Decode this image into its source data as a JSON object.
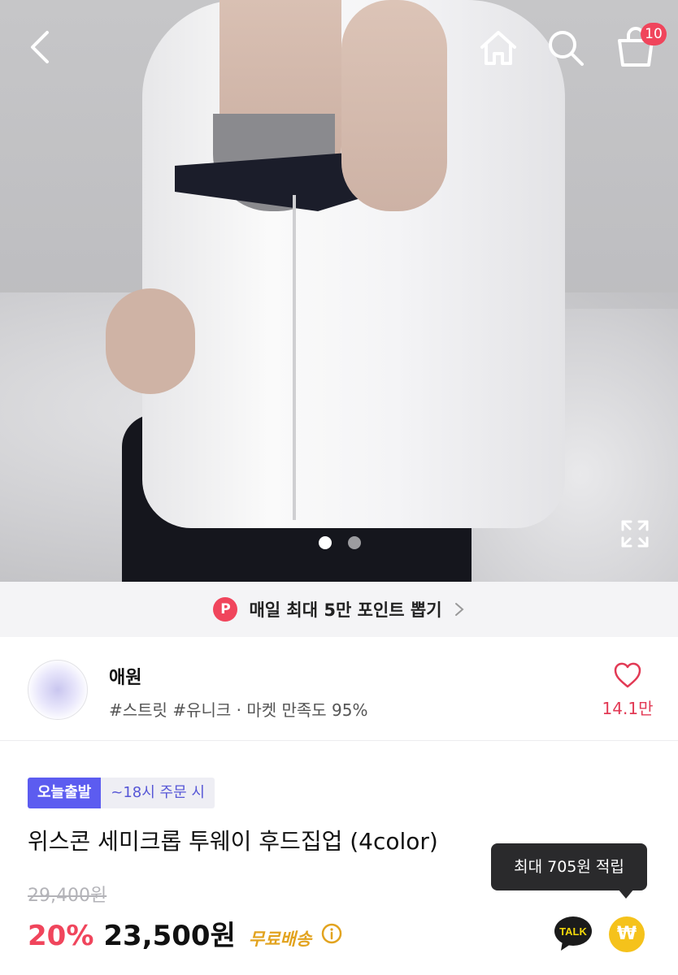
{
  "header": {
    "cart_count": "10"
  },
  "promo": {
    "icon_letter": "P",
    "text": "매일 최대 5만 포인트 뽑기"
  },
  "store": {
    "name": "애원",
    "tags": "#스트릿 #유니크 · 마켓 만족도 95%",
    "likes": "14.1만"
  },
  "product": {
    "badge_today": "오늘출발",
    "badge_time": "~18시 주문 시",
    "title": "위스콘 세미크롭 투웨이 후드집업 (4color)",
    "original_price": "29,400원",
    "discount": "20%",
    "price": "23,500원",
    "shipping": "무료배송"
  },
  "reward": {
    "tooltip": "최대 705원 적립",
    "talk_label": "TALK",
    "coin_symbol": "₩"
  },
  "carousel": {
    "current": 1,
    "total": 2
  },
  "colors": {
    "accent_red": "#f0455c",
    "badge_purple": "#5c5cf0",
    "shipping_gold": "#e2a31f",
    "coin_yellow": "#f5c21b"
  },
  "icons": [
    "back-arrow-icon",
    "home-icon",
    "search-icon",
    "cart-icon",
    "expand-icon",
    "chevron-right-icon",
    "heart-icon",
    "info-icon",
    "kakao-talk-icon",
    "coin-icon"
  ]
}
